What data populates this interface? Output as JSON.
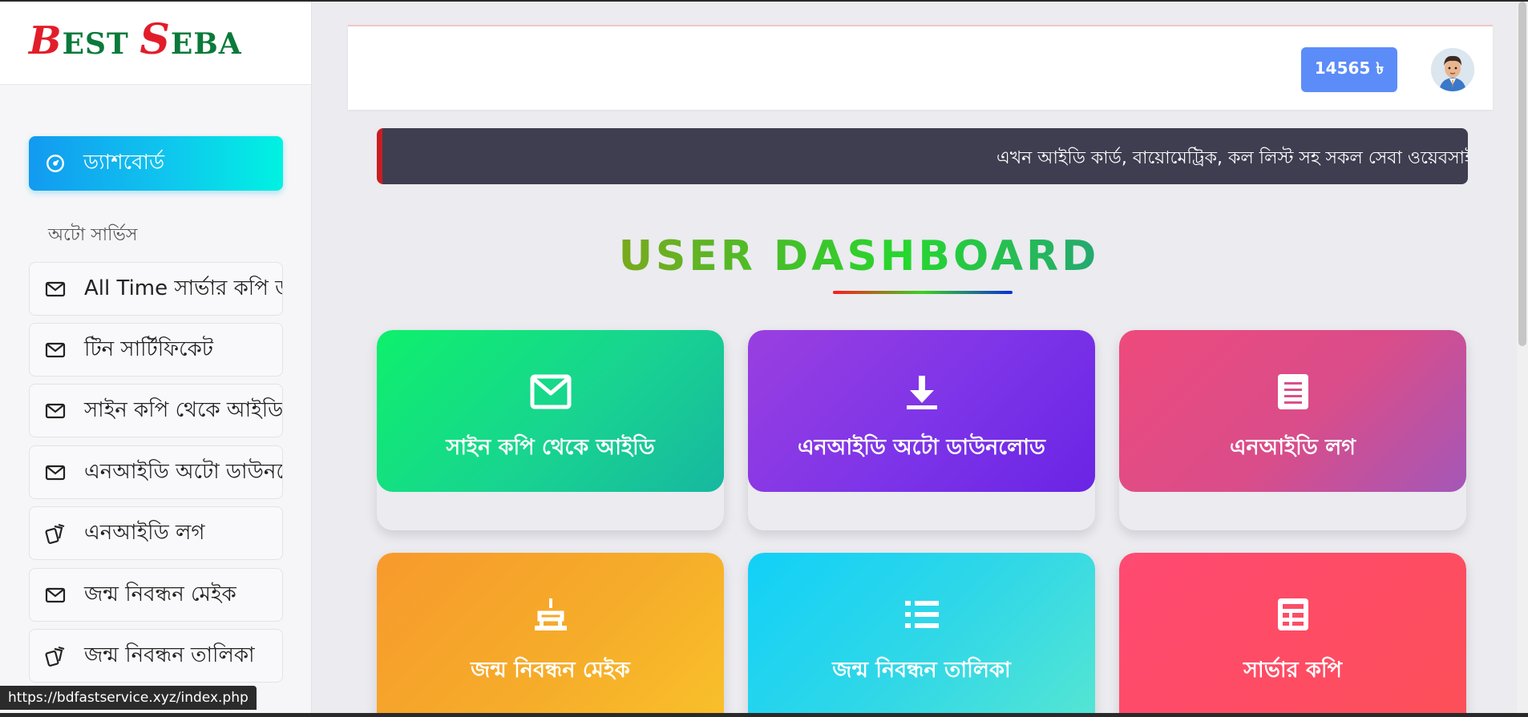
{
  "brand": {
    "b": "B",
    "est": "EST ",
    "s": "S",
    "eba": "EBA"
  },
  "sidebar": {
    "active": {
      "label": "ড্যাশবোর্ড"
    },
    "section_title": "অটো সার্ভিস",
    "items": [
      {
        "label": "All Time সার্ভার কপি ডাউনলোড",
        "icon": "mail-icon"
      },
      {
        "label": "টিন সার্টিফিকেট",
        "icon": "mail-icon"
      },
      {
        "label": "সাইন কপি থেকে আইডি",
        "icon": "mail-icon"
      },
      {
        "label": "এনআইডি অটো ডাউনলোড",
        "icon": "mail-icon"
      },
      {
        "label": "এনআইডি লগ",
        "icon": "cards-icon"
      },
      {
        "label": "জন্ম নিবন্ধন মেইক",
        "icon": "mail-icon"
      },
      {
        "label": "জন্ম নিবন্ধন তালিকা",
        "icon": "cards-icon"
      }
    ]
  },
  "header": {
    "balance": "14565 ৳"
  },
  "notice": {
    "text": "এখন আইডি কার্ড, বায়োমেট্রিক, কল লিস্ট সহ সকল সেবা ওয়েবসাইটে"
  },
  "dashboard": {
    "title": "USER DASHBOARD"
  },
  "cards": [
    {
      "label": "সাইন কপি থেকে আইডি",
      "icon": "envelope-icon"
    },
    {
      "label": "এনআইডি অটো ডাউনলোড",
      "icon": "download-icon"
    },
    {
      "label": "এনআইডি লগ",
      "icon": "document-icon"
    },
    {
      "label": "জন্ম নিবন্ধন মেইক",
      "icon": "cake-icon"
    },
    {
      "label": "জন্ম নিবন্ধন তালিকা",
      "icon": "list-icon"
    },
    {
      "label": "সার্ভার কপি",
      "icon": "server-icon"
    }
  ],
  "status_bar": {
    "url": "https://bdfastservice.xyz/index.php"
  },
  "colors": {
    "accent": "#5b8cf8",
    "notice_bg": "#3f3d50"
  }
}
